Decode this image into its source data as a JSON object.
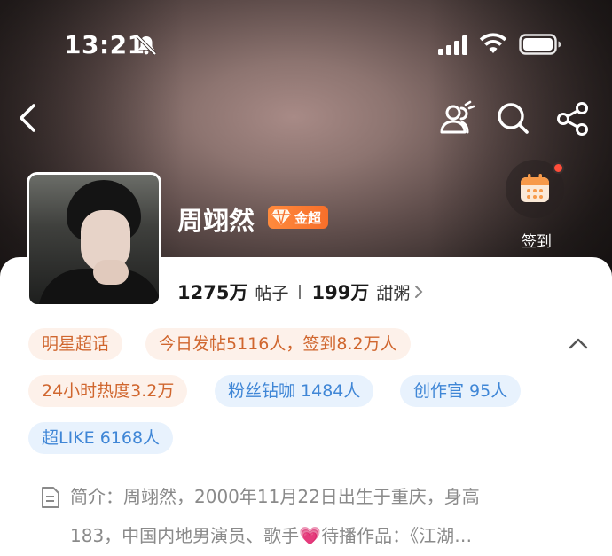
{
  "status_bar": {
    "time": "13:21",
    "icons": [
      "bell-slash-icon",
      "signal-icon",
      "wifi-icon",
      "battery-icon"
    ]
  },
  "nav": {
    "icons": [
      "back-icon",
      "group-chat-icon",
      "search-icon",
      "share-icon"
    ]
  },
  "profile": {
    "name": "周翊然",
    "badge_label": "金超",
    "posts_count": "1275万",
    "posts_label": "帖子",
    "fans_count": "199万",
    "fans_label": "甜粥"
  },
  "checkin": {
    "label": "签到",
    "icon": "calendar-icon"
  },
  "tags": {
    "row1": [
      "明星超话",
      "今日发帖5116人，签到8.2万人"
    ],
    "row2": [
      "24小时热度3.2万",
      "粉丝钻咖 1484人",
      "创作官 95人"
    ],
    "row3": [
      "超LIKE 6168人"
    ]
  },
  "intro": {
    "line1": "简介：周翊然，2000年11月22日出生于重庆，身高",
    "line2_a": "183，中国内地男演员、歌手",
    "heart": "💗",
    "line2_b": "待播作品：《江湖…"
  },
  "colors": {
    "accent_orange": "#f76f2a",
    "tag_orange_text": "#d0662e",
    "tag_blue_text": "#3f86d6",
    "checkin_dot": "#ff4d3a"
  }
}
